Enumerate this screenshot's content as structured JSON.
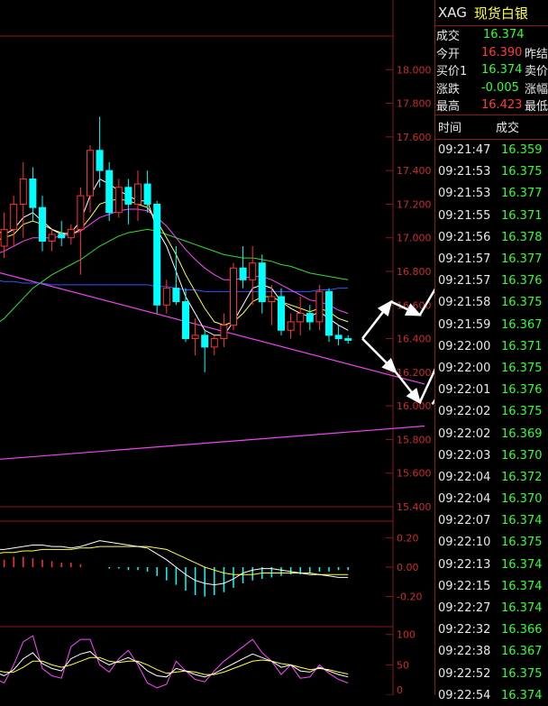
{
  "quote": {
    "symbol": "XAG",
    "name": "现货白银",
    "fields": [
      {
        "label": "成交",
        "value": "16.374",
        "color": "green",
        "label2": ""
      },
      {
        "label": "今开",
        "value": "16.390",
        "color": "red",
        "label2": "昨结"
      },
      {
        "label": "买价1",
        "value": "16.374",
        "color": "green",
        "label2": "卖价"
      },
      {
        "label": "涨跌",
        "value": "-0.005",
        "color": "green",
        "label2": "涨幅"
      },
      {
        "label": "最高",
        "value": "16.423",
        "color": "red",
        "label2": "最低"
      }
    ],
    "ticks_header": {
      "time": "时间",
      "price": "成交"
    },
    "ticks": [
      {
        "time": "09:21:47",
        "price": "16.359"
      },
      {
        "time": "09:21:53",
        "price": "16.375"
      },
      {
        "time": "09:21:53",
        "price": "16.377"
      },
      {
        "time": "09:21:55",
        "price": "16.371"
      },
      {
        "time": "09:21:56",
        "price": "16.378"
      },
      {
        "time": "09:21:57",
        "price": "16.377"
      },
      {
        "time": "09:21:57",
        "price": "16.376"
      },
      {
        "time": "09:21:58",
        "price": "16.375"
      },
      {
        "time": "09:21:59",
        "price": "16.367"
      },
      {
        "time": "09:22:00",
        "price": "16.371"
      },
      {
        "time": "09:22:00",
        "price": "16.375"
      },
      {
        "time": "09:22:01",
        "price": "16.376"
      },
      {
        "time": "09:22:02",
        "price": "16.375"
      },
      {
        "time": "09:22:02",
        "price": "16.369"
      },
      {
        "time": "09:22:03",
        "price": "16.370"
      },
      {
        "time": "09:22:04",
        "price": "16.372"
      },
      {
        "time": "09:22:04",
        "price": "16.370"
      },
      {
        "time": "09:22:07",
        "price": "16.374"
      },
      {
        "time": "09:22:10",
        "price": "16.375"
      },
      {
        "time": "09:22:13",
        "price": "16.374"
      },
      {
        "time": "09:22:15",
        "price": "16.374"
      },
      {
        "time": "09:22:27",
        "price": "16.374"
      },
      {
        "time": "09:22:32",
        "price": "16.366"
      },
      {
        "time": "09:22:38",
        "price": "16.367"
      },
      {
        "time": "09:22:52",
        "price": "16.375"
      },
      {
        "time": "09:22:54",
        "price": "16.374"
      }
    ]
  },
  "chart_data": {
    "type": "candlestick",
    "colors": {
      "up": "#ff3333",
      "down": "#00ffff",
      "grid": "#8a1a1a",
      "axis": "#cc2b2b",
      "ma_white": "#ffffff",
      "ma_yellow": "#ffff44",
      "ma_magenta": "#ff44ff",
      "ma_green": "#33dd33",
      "ma_blue": "#3355ff",
      "arrow": "#ffffff"
    },
    "main": {
      "ylim": [
        15.4,
        18.2
      ],
      "yticks": [
        "18.000",
        "17.800",
        "17.600",
        "17.400",
        "17.200",
        "17.000",
        "16.800",
        "16.600",
        "16.400",
        "16.200",
        "16.000",
        "15.800",
        "15.600",
        "15.400"
      ],
      "candles": [
        {
          "o": 17.1,
          "h": 17.22,
          "l": 16.9,
          "c": 16.95
        },
        {
          "o": 16.95,
          "h": 17.15,
          "l": 16.88,
          "c": 17.05
        },
        {
          "o": 17.05,
          "h": 17.25,
          "l": 16.95,
          "c": 17.2
        },
        {
          "o": 17.2,
          "h": 17.45,
          "l": 17.0,
          "c": 17.35
        },
        {
          "o": 17.35,
          "h": 17.42,
          "l": 17.1,
          "c": 17.18
        },
        {
          "o": 17.18,
          "h": 17.25,
          "l": 16.92,
          "c": 16.98
        },
        {
          "o": 16.98,
          "h": 17.05,
          "l": 16.92,
          "c": 17.02
        },
        {
          "o": 17.02,
          "h": 17.1,
          "l": 16.95,
          "c": 17.0
        },
        {
          "o": 17.0,
          "h": 17.08,
          "l": 16.96,
          "c": 17.05
        },
        {
          "o": 17.05,
          "h": 17.3,
          "l": 16.78,
          "c": 17.25
        },
        {
          "o": 17.25,
          "h": 17.55,
          "l": 17.15,
          "c": 17.52
        },
        {
          "o": 17.52,
          "h": 17.72,
          "l": 17.3,
          "c": 17.4
        },
        {
          "o": 17.4,
          "h": 17.45,
          "l": 17.1,
          "c": 17.15
        },
        {
          "o": 17.15,
          "h": 17.35,
          "l": 17.12,
          "c": 17.3
        },
        {
          "o": 17.3,
          "h": 17.35,
          "l": 17.08,
          "c": 17.2
        },
        {
          "o": 17.2,
          "h": 17.4,
          "l": 17.1,
          "c": 17.32
        },
        {
          "o": 17.32,
          "h": 17.4,
          "l": 17.15,
          "c": 17.2
        },
        {
          "o": 17.2,
          "h": 17.22,
          "l": 16.55,
          "c": 16.6
        },
        {
          "o": 16.6,
          "h": 16.75,
          "l": 16.55,
          "c": 16.7
        },
        {
          "o": 16.7,
          "h": 16.95,
          "l": 16.6,
          "c": 16.62
        },
        {
          "o": 16.62,
          "h": 16.7,
          "l": 16.38,
          "c": 16.4
        },
        {
          "o": 16.4,
          "h": 16.52,
          "l": 16.3,
          "c": 16.42
        },
        {
          "o": 16.42,
          "h": 16.45,
          "l": 16.2,
          "c": 16.35
        },
        {
          "o": 16.35,
          "h": 16.42,
          "l": 16.3,
          "c": 16.4
        },
        {
          "o": 16.4,
          "h": 16.55,
          "l": 16.35,
          "c": 16.48
        },
        {
          "o": 16.48,
          "h": 16.85,
          "l": 16.45,
          "c": 16.82
        },
        {
          "o": 16.82,
          "h": 16.95,
          "l": 16.7,
          "c": 16.75
        },
        {
          "o": 16.75,
          "h": 16.95,
          "l": 16.6,
          "c": 16.85
        },
        {
          "o": 16.85,
          "h": 16.9,
          "l": 16.55,
          "c": 16.62
        },
        {
          "o": 16.62,
          "h": 16.72,
          "l": 16.48,
          "c": 16.65
        },
        {
          "o": 16.65,
          "h": 16.7,
          "l": 16.42,
          "c": 16.45
        },
        {
          "o": 16.45,
          "h": 16.55,
          "l": 16.4,
          "c": 16.5
        },
        {
          "o": 16.5,
          "h": 16.65,
          "l": 16.42,
          "c": 16.55
        },
        {
          "o": 16.55,
          "h": 16.6,
          "l": 16.45,
          "c": 16.5
        },
        {
          "o": 16.5,
          "h": 16.72,
          "l": 16.45,
          "c": 16.68
        },
        {
          "o": 16.68,
          "h": 16.7,
          "l": 16.38,
          "c": 16.42
        },
        {
          "o": 16.42,
          "h": 16.48,
          "l": 16.36,
          "c": 16.4
        },
        {
          "o": 16.4,
          "h": 16.42,
          "l": 16.37,
          "c": 16.39
        }
      ],
      "ma_white": [
        17.05,
        17.02,
        17.05,
        17.12,
        17.15,
        17.1,
        17.05,
        17.02,
        17.03,
        17.1,
        17.25,
        17.35,
        17.32,
        17.28,
        17.25,
        17.22,
        17.22,
        17.05,
        16.95,
        16.8,
        16.65,
        16.55,
        16.45,
        16.42,
        16.42,
        16.5,
        16.6,
        16.7,
        16.72,
        16.7,
        16.62,
        16.58,
        16.55,
        16.53,
        16.56,
        16.52,
        16.48,
        16.45
      ],
      "ma_yellow": [
        16.98,
        17.0,
        17.02,
        17.08,
        17.1,
        17.08,
        17.05,
        17.03,
        17.02,
        17.05,
        17.12,
        17.2,
        17.22,
        17.23,
        17.22,
        17.2,
        17.18,
        17.1,
        17.0,
        16.9,
        16.78,
        16.68,
        16.58,
        16.5,
        16.48,
        16.5,
        16.55,
        16.62,
        16.65,
        16.65,
        16.62,
        16.6,
        16.58,
        16.56,
        16.58,
        16.56,
        16.52,
        16.5
      ],
      "ma_magenta": [
        16.9,
        16.92,
        16.95,
        16.98,
        17.0,
        17.0,
        17.0,
        17.01,
        17.02,
        17.04,
        17.08,
        17.12,
        17.14,
        17.16,
        17.17,
        17.17,
        17.16,
        17.12,
        17.07,
        17.0,
        16.93,
        16.87,
        16.82,
        16.78,
        16.75,
        16.75,
        16.76,
        16.77,
        16.77,
        16.75,
        16.72,
        16.69,
        16.66,
        16.63,
        16.62,
        16.6,
        16.57,
        16.55
      ],
      "ma_green": [
        16.48,
        16.52,
        16.58,
        16.64,
        16.7,
        16.74,
        16.78,
        16.81,
        16.84,
        16.87,
        16.91,
        16.95,
        16.98,
        17.01,
        17.03,
        17.04,
        17.05,
        17.04,
        17.02,
        17.0,
        16.98,
        16.96,
        16.94,
        16.92,
        16.9,
        16.89,
        16.88,
        16.88,
        16.87,
        16.86,
        16.84,
        16.83,
        16.81,
        16.79,
        16.78,
        16.77,
        16.76,
        16.75
      ],
      "ma_blue": [
        16.75,
        16.74,
        16.74,
        16.73,
        16.73,
        16.73,
        16.72,
        16.72,
        16.72,
        16.72,
        16.72,
        16.72,
        16.72,
        16.72,
        16.72,
        16.72,
        16.72,
        16.71,
        16.71,
        16.7,
        16.69,
        16.69,
        16.68,
        16.68,
        16.68,
        16.68,
        16.68,
        16.68,
        16.68,
        16.68,
        16.68,
        16.68,
        16.68,
        16.68,
        16.69,
        16.69,
        16.7,
        16.7
      ],
      "trend_lines": [
        {
          "from": [
            0,
            16.8
          ],
          "to": [
            45,
            16.13
          ]
        },
        {
          "from": [
            0,
            15.68
          ],
          "to": [
            45,
            15.88
          ]
        }
      ],
      "annotation_arrows": [
        [
          38.5,
          16.4,
          41.5,
          16.62
        ],
        [
          41.5,
          16.62,
          44.5,
          16.54
        ],
        [
          44.5,
          16.54,
          49.5,
          17.02
        ],
        [
          38.5,
          16.4,
          42,
          16.2
        ],
        [
          42,
          16.2,
          44.5,
          16.02
        ],
        [
          44.5,
          16.02,
          48,
          16.45
        ],
        [
          51.5,
          16.6,
          58,
          17.46
        ],
        [
          51.5,
          16.9,
          56,
          16.7
        ],
        [
          45.8,
          16.01,
          53.4,
          16.64
        ]
      ]
    },
    "macd": {
      "ylim": [
        -0.3,
        0.3
      ],
      "yticks": [
        "0.20",
        "0.00",
        "-0.20"
      ],
      "hist": [
        0.06,
        0.05,
        0.07,
        0.07,
        0.06,
        0.05,
        0.04,
        0.03,
        0.03,
        0.02,
        0.0,
        0.0,
        -0.01,
        -0.01,
        -0.02,
        -0.02,
        -0.03,
        -0.06,
        -0.09,
        -0.12,
        -0.16,
        -0.19,
        -0.2,
        -0.19,
        -0.17,
        -0.14,
        -0.11,
        -0.09,
        -0.08,
        -0.07,
        -0.06,
        -0.05,
        -0.05,
        -0.04,
        -0.03,
        -0.03,
        -0.02,
        -0.02
      ],
      "dif": [
        0.12,
        0.12,
        0.13,
        0.14,
        0.15,
        0.15,
        0.14,
        0.14,
        0.13,
        0.14,
        0.16,
        0.18,
        0.17,
        0.16,
        0.15,
        0.14,
        0.13,
        0.09,
        0.05,
        0.0,
        -0.05,
        -0.09,
        -0.11,
        -0.12,
        -0.11,
        -0.08,
        -0.04,
        -0.02,
        -0.01,
        -0.01,
        -0.02,
        -0.03,
        -0.04,
        -0.05,
        -0.05,
        -0.06,
        -0.07,
        -0.07
      ],
      "dea": [
        0.09,
        0.1,
        0.1,
        0.11,
        0.11,
        0.12,
        0.12,
        0.12,
        0.12,
        0.13,
        0.13,
        0.14,
        0.14,
        0.14,
        0.14,
        0.14,
        0.14,
        0.13,
        0.12,
        0.09,
        0.06,
        0.03,
        0.0,
        -0.02,
        -0.04,
        -0.05,
        -0.05,
        -0.05,
        -0.04,
        -0.04,
        -0.04,
        -0.04,
        -0.04,
        -0.04,
        -0.05,
        -0.05,
        -0.05,
        -0.05
      ]
    },
    "kdj": {
      "ylim": [
        0,
        110
      ],
      "yticks": [
        "100",
        "50",
        "0"
      ],
      "k": [
        38,
        32,
        42,
        60,
        70,
        52,
        44,
        40,
        60,
        68,
        72,
        58,
        50,
        56,
        62,
        54,
        40,
        32,
        30,
        44,
        40,
        34,
        30,
        36,
        44,
        52,
        60,
        68,
        62,
        56,
        46,
        50,
        40,
        38,
        46,
        40,
        34,
        30
      ],
      "d": [
        42,
        38,
        38,
        46,
        56,
        56,
        50,
        46,
        50,
        56,
        62,
        62,
        56,
        54,
        56,
        56,
        50,
        42,
        36,
        38,
        40,
        38,
        34,
        34,
        38,
        44,
        50,
        56,
        58,
        56,
        52,
        50,
        46,
        42,
        44,
        42,
        38,
        35
      ],
      "j": [
        28,
        20,
        50,
        88,
        98,
        44,
        32,
        28,
        80,
        92,
        92,
        50,
        38,
        60,
        74,
        50,
        20,
        12,
        18,
        56,
        40,
        26,
        22,
        40,
        56,
        68,
        80,
        92,
        70,
        56,
        34,
        50,
        28,
        30,
        50,
        36,
        26,
        20
      ]
    }
  }
}
